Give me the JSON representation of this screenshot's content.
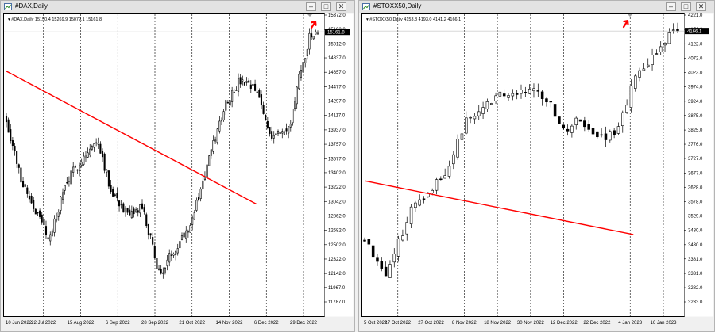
{
  "windows": [
    {
      "id": "left",
      "title": "#DAX,Daily",
      "info": {
        "symbol": "#DAX,Daily",
        "ohlc": "15150.4 15269.9 15079.1 15161.8"
      },
      "current_price_label": "15161.8",
      "controls": {
        "minimize": "–",
        "maximize": "□",
        "close": "✕"
      }
    },
    {
      "id": "right",
      "title": "#STOXX50,Daily",
      "info": {
        "symbol": "#STOXX50,Daily",
        "ohlc": "4153.8 4193.0 4141.2 4166.1"
      },
      "current_price_label": "4166.1",
      "controls": {
        "minimize": "–",
        "maximize": "□",
        "close": "✕"
      }
    }
  ],
  "chart_data": [
    {
      "type": "candlestick",
      "title": "#DAX,Daily",
      "y_ticks": [
        15372.0,
        15192.0,
        15012.0,
        14837.0,
        14657.0,
        14477.0,
        14297.0,
        14117.0,
        13937.0,
        13757.0,
        13577.0,
        13402.0,
        13222.0,
        13042.0,
        12862.0,
        12682.0,
        12502.0,
        12322.0,
        12142.0,
        11967.0,
        11787.0
      ],
      "ylim": [
        11787.0,
        15372.0
      ],
      "x_tick_labels": [
        "10 Jun 2022",
        "22 Jul 2022",
        "15 Aug 2022",
        "6 Sep 2022",
        "28 Sep 2022",
        "21 Oct 2022",
        "14 Nov 2022",
        "6 Dec 2022",
        "29 Dec 2022"
      ],
      "current_price": 15161.8,
      "series": [
        {
          "x": [
            "2022-06-10",
            "2022-06-20",
            "2022-06-30",
            "2022-07-11",
            "2022-07-22",
            "2022-08-02",
            "2022-08-15",
            "2022-08-23",
            "2022-09-06",
            "2022-09-15",
            "2022-09-28",
            "2022-10-06",
            "2022-10-21",
            "2022-11-01",
            "2022-11-14",
            "2022-11-24",
            "2022-12-06",
            "2022-12-16",
            "2022-12-29",
            "2023-01-06",
            "2023-01-13",
            "2023-01-19"
          ],
          "close": [
            14070,
            13350,
            12960,
            12570,
            13240,
            13560,
            13800,
            13230,
            12830,
            12980,
            12110,
            12380,
            12810,
            13500,
            14280,
            14540,
            14430,
            13880,
            13920,
            14610,
            15080,
            15161.8
          ]
        }
      ],
      "trendline": {
        "x": [
          "2022-06-10",
          "2022-12-06"
        ],
        "y": [
          14670,
          13010
        ]
      },
      "annotation": "up-arrow"
    },
    {
      "type": "candlestick",
      "title": "#STOXX50,Daily",
      "y_ticks": [
        4221.0,
        4171.9,
        4122.0,
        4072.0,
        4023.0,
        3974.0,
        3924.0,
        3875.0,
        3825.0,
        3776.0,
        3727.0,
        3677.0,
        3628.0,
        3578.0,
        3529.0,
        3480.0,
        3430.0,
        3381.0,
        3331.0,
        3282.0,
        3233.0
      ],
      "ylim": [
        3233.0,
        4221.0
      ],
      "x_tick_labels": [
        "5 Oct 2022",
        "17 Oct 2022",
        "27 Oct 2022",
        "8 Nov 2022",
        "18 Nov 2022",
        "30 Nov 2022",
        "12 Dec 2022",
        "22 Dec 2022",
        "4 Jan 2023",
        "16 Jan 2023"
      ],
      "current_price": 4166.1,
      "series": [
        {
          "x": [
            "2022-10-05",
            "2022-10-12",
            "2022-10-17",
            "2022-10-21",
            "2022-10-27",
            "2022-11-02",
            "2022-11-08",
            "2022-11-14",
            "2022-11-18",
            "2022-11-24",
            "2022-11-30",
            "2022-12-06",
            "2022-12-12",
            "2022-12-16",
            "2022-12-22",
            "2022-12-29",
            "2023-01-04",
            "2023-01-09",
            "2023-01-16",
            "2023-01-19"
          ],
          "close": [
            3450,
            3330,
            3450,
            3560,
            3620,
            3690,
            3850,
            3900,
            3940,
            3950,
            3965,
            3930,
            3820,
            3855,
            3800,
            3810,
            3990,
            4050,
            4150,
            4166.1
          ]
        }
      ],
      "trendline": {
        "x": [
          "2022-10-05",
          "2023-01-04"
        ],
        "y": [
          3650,
          3465
        ]
      },
      "annotation": "up-arrow"
    }
  ]
}
